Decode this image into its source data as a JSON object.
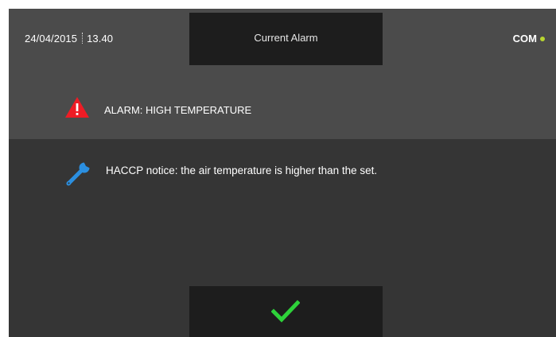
{
  "header": {
    "date": "24/04/2015",
    "time": "13.40",
    "title": "Current Alarm",
    "com_label": "COM",
    "com_status_color": "#b8d630"
  },
  "alarm": {
    "icon": "warning-triangle-icon",
    "icon_color": "#ee1c25",
    "text": "ALARM: HIGH TEMPERATURE"
  },
  "notice": {
    "icon": "wrench-icon",
    "icon_color": "#2b8fe0",
    "text": "HACCP notice: the air temperature is higher than the set."
  },
  "confirm": {
    "icon": "checkmark-icon",
    "icon_color": "#2ed23a"
  },
  "colors": {
    "header_bg": "#4b4b4b",
    "body_bg": "#353535",
    "box_bg": "#1d1d1d"
  }
}
